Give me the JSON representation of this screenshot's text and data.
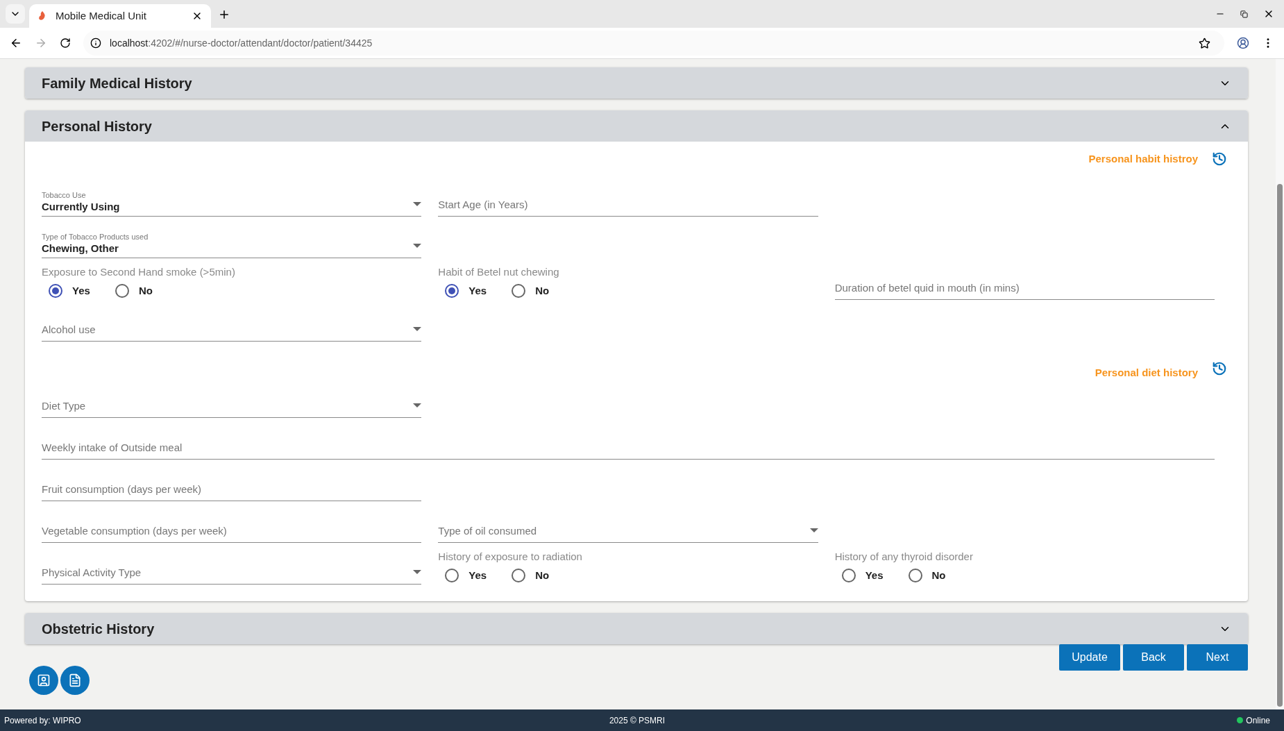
{
  "browser": {
    "tab_title": "Mobile Medical Unit",
    "url_host": "localhost",
    "url_path": ":4202/#/nurse-doctor/attendant/doctor/patient/34425"
  },
  "sections": [
    {
      "title": "Family Medical History",
      "expanded": false
    },
    {
      "title": "Personal History",
      "expanded": true,
      "rows": [
        {
          "kind": "link",
          "text": "Personal habit histroy"
        },
        {
          "kind": "fields",
          "fields": [
            {
              "kind": "select",
              "label": "Tobacco Use",
              "value": "Currently Using"
            },
            {
              "kind": "input",
              "placeholder": "Start Age (in Years)"
            }
          ]
        },
        {
          "kind": "fields",
          "fields": [
            {
              "kind": "select",
              "label": "Type of Tobacco Products used",
              "value": "Chewing, Other"
            }
          ]
        },
        {
          "kind": "fields",
          "fields": [
            {
              "kind": "radio",
              "label": "Exposure to Second Hand smoke (>5min)",
              "options": [
                {
                  "label": "Yes",
                  "selected": true
                },
                {
                  "label": "No",
                  "selected": false
                }
              ]
            },
            {
              "kind": "radio",
              "label": "Habit of Betel nut chewing",
              "options": [
                {
                  "label": "Yes",
                  "selected": true
                },
                {
                  "label": "No",
                  "selected": false
                }
              ]
            },
            {
              "kind": "input",
              "placeholder": "Duration of betel quid in mouth (in mins)"
            }
          ]
        },
        {
          "kind": "fields",
          "fields": [
            {
              "kind": "select",
              "placeholder": "Alcohol use"
            }
          ]
        },
        {
          "kind": "link",
          "text": "Personal diet history"
        },
        {
          "kind": "fields",
          "fields": [
            {
              "kind": "select",
              "placeholder": "Diet Type"
            }
          ]
        },
        {
          "kind": "fields",
          "fields": [
            {
              "kind": "wide_input",
              "placeholder": "Weekly intake of Outside meal"
            }
          ]
        },
        {
          "kind": "fields",
          "fields": [
            {
              "kind": "input",
              "placeholder": "Fruit consumption (days per week)"
            }
          ]
        },
        {
          "kind": "fields",
          "fields": [
            {
              "kind": "input",
              "placeholder": "Vegetable consumption (days per week)"
            },
            {
              "kind": "select",
              "placeholder": "Type of oil consumed"
            }
          ]
        },
        {
          "kind": "fields",
          "fields": [
            {
              "kind": "select",
              "placeholder": "Physical Activity Type"
            },
            {
              "kind": "radio",
              "label": "History of exposure to radiation",
              "options": [
                {
                  "label": "Yes",
                  "selected": false
                },
                {
                  "label": "No",
                  "selected": false
                }
              ]
            },
            {
              "kind": "radio",
              "label": "History of any thyroid disorder",
              "options": [
                {
                  "label": "Yes",
                  "selected": false
                },
                {
                  "label": "No",
                  "selected": false
                }
              ]
            }
          ]
        }
      ]
    },
    {
      "title": "Obstetric History",
      "expanded": false
    }
  ],
  "actions": [
    "Update",
    "Back",
    "Next"
  ],
  "footer": {
    "left": "Powered by: WIPRO",
    "center": "2025 © PSMRI",
    "status": "Online"
  }
}
